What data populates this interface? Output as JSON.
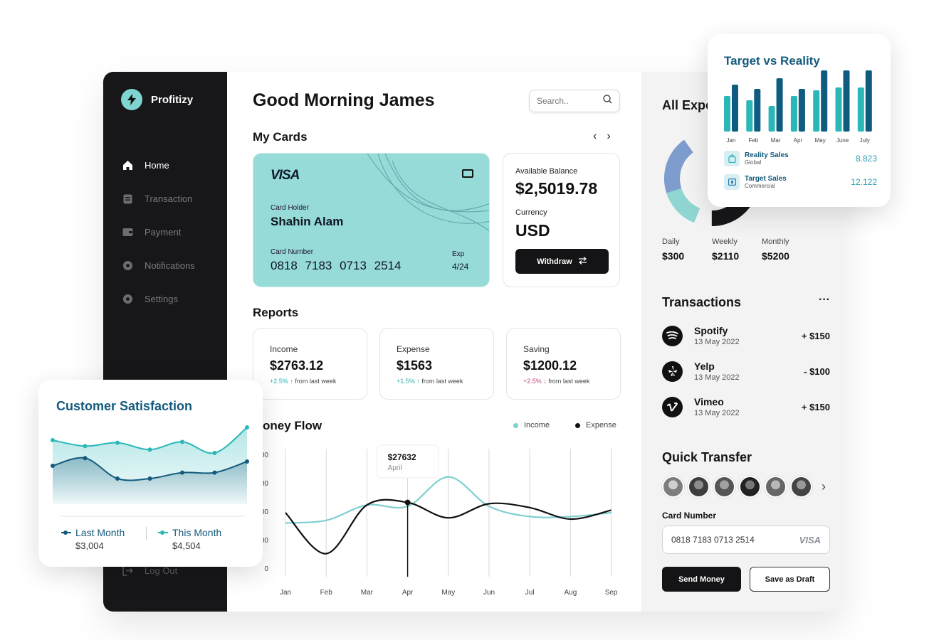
{
  "app": {
    "name": "Profitizy"
  },
  "sidebar": {
    "items": [
      {
        "label": "Home",
        "icon": "home-icon",
        "active": true
      },
      {
        "label": "Transaction",
        "icon": "clipboard-icon"
      },
      {
        "label": "Payment",
        "icon": "wallet-icon"
      },
      {
        "label": "Notifications",
        "icon": "gear-icon"
      },
      {
        "label": "Settings",
        "icon": "gear-icon"
      }
    ],
    "logout": "Log Out"
  },
  "header": {
    "greeting": "Good Morning James",
    "search_placeholder": "Search.."
  },
  "my_cards": {
    "title": "My Cards",
    "card": {
      "brand": "VISA",
      "holder_label": "Card Holder",
      "holder": "Shahin Alam",
      "number_label": "Card Number",
      "number": "0818 7183 0713 2514",
      "exp_label": "Exp",
      "exp": "4/24",
      "color": "#96dbd8"
    },
    "balance": {
      "label": "Available Balance",
      "value": "$2,5019.78",
      "currency_label": "Currency",
      "currency": "USD",
      "withdraw": "Withdraw"
    }
  },
  "reports": {
    "title": "Reports",
    "items": [
      {
        "label": "Income",
        "value": "$2763.12",
        "change": "+2.5%",
        "direction": "up",
        "note": "from last week"
      },
      {
        "label": "Expense",
        "value": "$1563",
        "change": "+1.5%",
        "direction": "up",
        "note": "from last week"
      },
      {
        "label": "Saving",
        "value": "$1200.12",
        "change": "+2.5%",
        "direction": "down",
        "note": "from last week"
      }
    ]
  },
  "money_flow": {
    "title": "oney Flow",
    "legend": {
      "income": "Income",
      "expense": "Expense"
    },
    "tooltip": {
      "value": "$27632",
      "label": "April"
    },
    "y_ticks": [
      "00",
      "00",
      "00",
      "00",
      "0"
    ],
    "x_ticks": [
      "Jan",
      "Feb",
      "Mar",
      "Apr",
      "May",
      "Jun",
      "Jul",
      "Aug",
      "Sep"
    ]
  },
  "expenses": {
    "title": "All Expe",
    "stats": [
      {
        "label": "Daily",
        "value": "$300"
      },
      {
        "label": "Weekly",
        "value": "$2110"
      },
      {
        "label": "Monthly",
        "value": "$5200"
      }
    ]
  },
  "transactions": {
    "title": "Transactions",
    "more": "···",
    "items": [
      {
        "name": "Spotify",
        "date": "13 May 2022",
        "amount": "+ $150",
        "icon": "spotify-icon"
      },
      {
        "name": "Yelp",
        "date": "13 May 2022",
        "amount": "- $100",
        "icon": "yelp-icon"
      },
      {
        "name": "Vimeo",
        "date": "13 May 2022",
        "amount": "+ $150",
        "icon": "vimeo-icon"
      }
    ]
  },
  "quick_transfer": {
    "title": "Quick Transfer",
    "card_number_label": "Card Number",
    "card_number": "0818 7183 0713 2514",
    "card_brand": "VISA",
    "send": "Send Money",
    "draft": "Save as Draft",
    "next": "›"
  },
  "target_vs_reality": {
    "title": "Target vs Reality",
    "legend": [
      {
        "name": "Reality Sales",
        "sub": "Global",
        "value": "8.823"
      },
      {
        "name": "Target Sales",
        "sub": "Commercial",
        "value": "12.122"
      }
    ]
  },
  "customer_satisfaction": {
    "title": "Customer Satisfaction",
    "legend": [
      {
        "name": "Last Month",
        "value": "$3,004"
      },
      {
        "name": "This Month",
        "value": "$4,504"
      }
    ]
  },
  "chart_data": [
    {
      "type": "bar",
      "title": "Target vs Reality",
      "categories": [
        "Jan",
        "Feb",
        "Mar",
        "Apr",
        "May",
        "June",
        "July"
      ],
      "series": [
        {
          "name": "Reality Sales",
          "values": [
            50,
            44,
            36,
            50,
            58,
            62,
            62
          ],
          "color": "#2ab7b8"
        },
        {
          "name": "Target Sales",
          "values": [
            66,
            60,
            75,
            60,
            86,
            86,
            86
          ],
          "color": "#0f5c80"
        }
      ],
      "ylim": [
        0,
        90
      ]
    },
    {
      "type": "line",
      "title": "Money Flow",
      "categories": [
        "Jan",
        "Feb",
        "Mar",
        "Apr",
        "May",
        "Jun",
        "Jul",
        "Aug",
        "Sep"
      ],
      "series": [
        {
          "name": "Income",
          "values": [
            42,
            44,
            56,
            55,
            78,
            55,
            47,
            47,
            50
          ],
          "color": "#7fd0cf"
        },
        {
          "name": "Expense",
          "values": [
            50,
            18,
            56,
            58,
            46,
            57,
            54,
            45,
            52
          ],
          "color": "#111111"
        }
      ],
      "ylim": [
        0,
        100
      ]
    },
    {
      "type": "area",
      "title": "Customer Satisfaction",
      "x": [
        1,
        2,
        3,
        4,
        5,
        6,
        7
      ],
      "series": [
        {
          "name": "Last Month",
          "values": [
            45,
            54,
            30,
            30,
            37,
            37,
            50
          ],
          "color": "#135a7c"
        },
        {
          "name": "This Month",
          "values": [
            75,
            68,
            72,
            64,
            73,
            60,
            90
          ],
          "color": "#2ab7b8"
        }
      ],
      "ylim": [
        0,
        100
      ]
    },
    {
      "type": "pie",
      "title": "All Expe",
      "labels": [
        "Teal",
        "Slate blue",
        "Black"
      ],
      "values": [
        30,
        20,
        50
      ],
      "colors": [
        "#8fd6d3",
        "#7f9ccf",
        "#17171a"
      ]
    }
  ]
}
